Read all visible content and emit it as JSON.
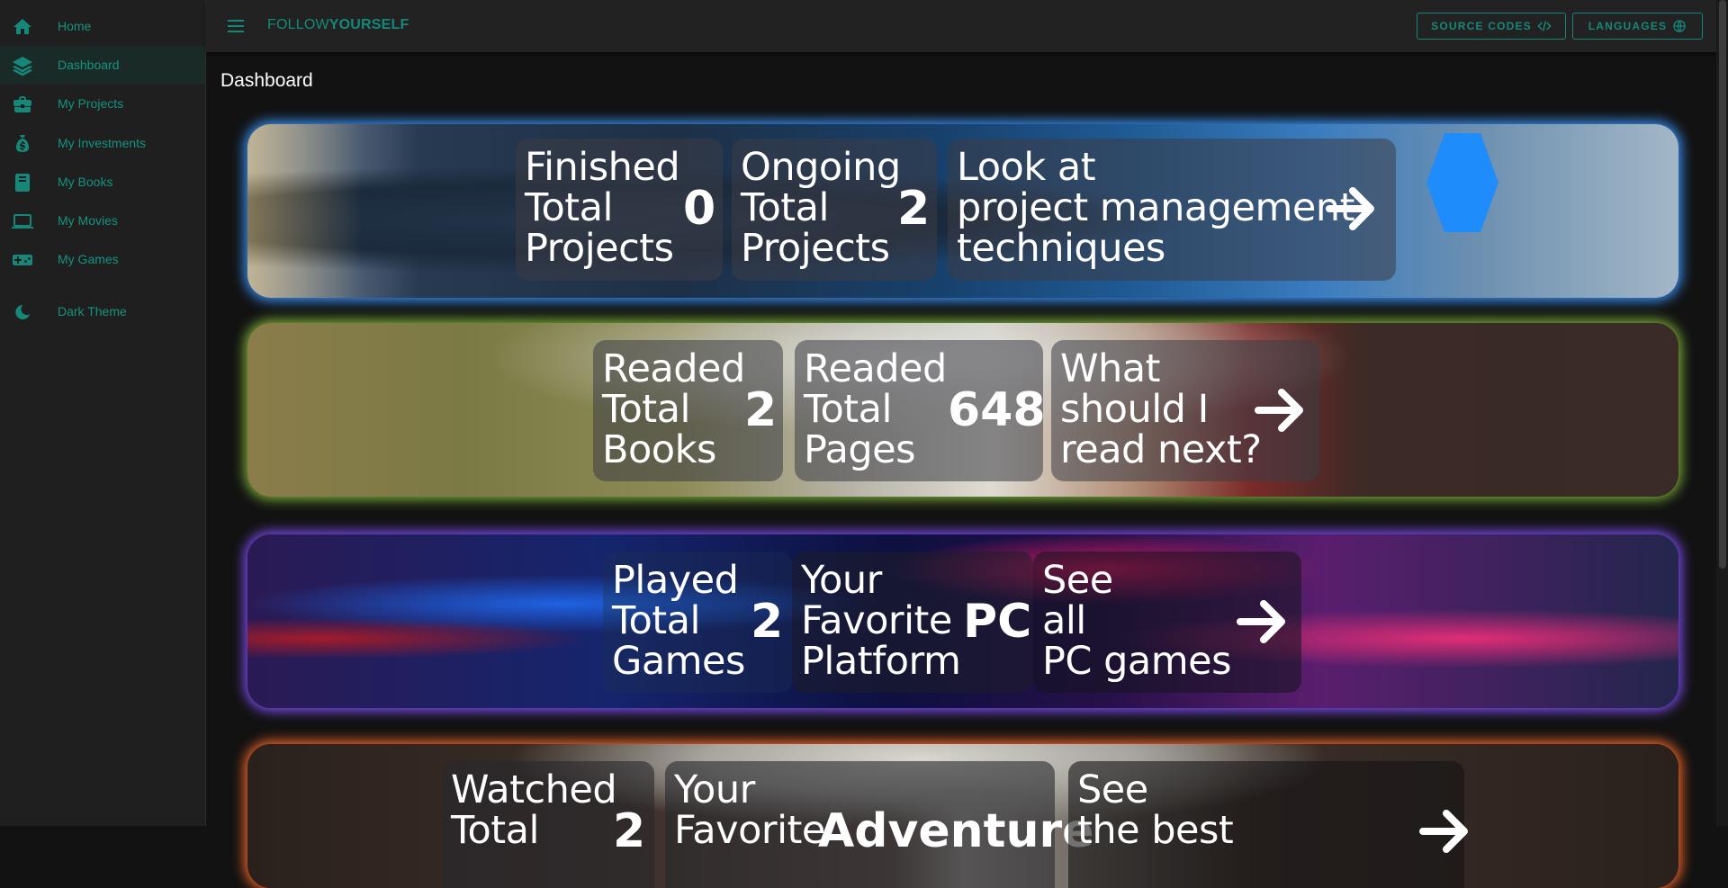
{
  "sidebar": {
    "items": [
      {
        "label": "Home",
        "icon": "home-icon"
      },
      {
        "label": "Dashboard",
        "icon": "layers-icon",
        "active": true
      },
      {
        "label": "My Projects",
        "icon": "briefcase-icon"
      },
      {
        "label": "My Investments",
        "icon": "money-bag-icon"
      },
      {
        "label": "My Books",
        "icon": "book-icon"
      },
      {
        "label": "My Movies",
        "icon": "monitor-icon"
      },
      {
        "label": "My Games",
        "icon": "gamepad-icon"
      }
    ],
    "theme_toggle": {
      "label": "Dark Theme",
      "icon": "moon-icon"
    }
  },
  "header": {
    "brand_light": "FOLLOW",
    "brand_bold": "YOURSELF",
    "source_button": "SOURCE CODES",
    "languages_button": "LANGUAGES"
  },
  "main": {
    "title": "Dashboard",
    "banners": {
      "projects": {
        "finished": {
          "label": "Finished\nTotal\nProjects",
          "value": "0"
        },
        "ongoing": {
          "label": "Ongoing\nTotal\nProjects",
          "value": "2"
        },
        "link": {
          "label": "Look at\nproject management\ntechniques"
        }
      },
      "books": {
        "books": {
          "label": "Readed\nTotal\nBooks",
          "value": "2"
        },
        "pages": {
          "label": "Readed\nTotal\nPages",
          "value": "648"
        },
        "link": {
          "label": "What\nshould I\nread next?"
        }
      },
      "games": {
        "played": {
          "label": "Played\nTotal\nGames",
          "value": "2"
        },
        "platform": {
          "label": "Your\nFavorite\nPlatform",
          "value": "PC"
        },
        "link": {
          "label": "See\nall\nPC games"
        }
      },
      "movies": {
        "watched": {
          "label": "Watched\nTotal",
          "value": "2"
        },
        "genre": {
          "label": "Your\nFavorite",
          "value": "Adventure"
        },
        "link": {
          "label": "See\nthe best"
        }
      }
    }
  },
  "colors": {
    "accent": "#16887a",
    "projects_glow": "#3a96ff",
    "books_glow": "#7fb33a",
    "games_glow": "#8250ff",
    "movies_glow": "#ff6a2a"
  }
}
